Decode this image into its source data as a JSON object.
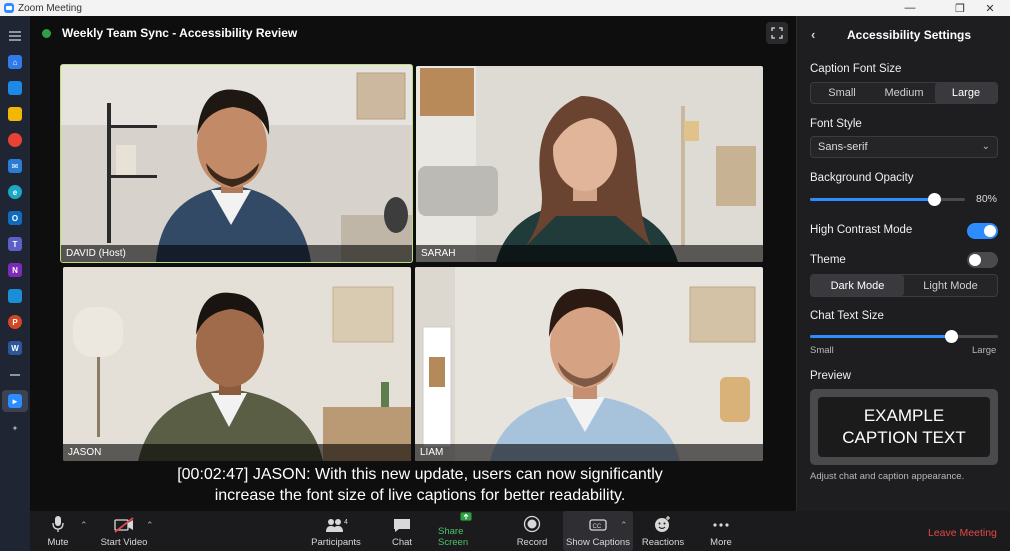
{
  "window": {
    "title": "Zoom Meeting"
  },
  "meeting": {
    "title": "Weekly Team Sync - Accessibility Review"
  },
  "participants": [
    {
      "name": "DAVID (Host)",
      "active_speaker": true
    },
    {
      "name": "SARAH",
      "active_speaker": false
    },
    {
      "name": "JASON",
      "active_speaker": false
    },
    {
      "name": "LIAM",
      "active_speaker": false
    }
  ],
  "caption": {
    "line1": "[00:02:47]  JASON: With this new update, users can now significantly",
    "line2": "increase the font size of live captions for better readability."
  },
  "panel": {
    "title": "Accessibility Settings",
    "caption_font_size": {
      "label": "Caption Font Size",
      "options": [
        "Small",
        "Medium",
        "Large"
      ],
      "selected": "Large"
    },
    "font_style": {
      "label": "Font Style",
      "value": "Sans-serif"
    },
    "background_opacity": {
      "label": "Background Opacity",
      "value": 0.8,
      "display": "80%"
    },
    "high_contrast": {
      "label": "High Contrast Mode",
      "on": true
    },
    "theme": {
      "label": "Theme",
      "on": false,
      "options": [
        "Dark Mode",
        "Light Mode"
      ],
      "selected": "Dark Mode"
    },
    "chat_text_size": {
      "label": "Chat Text Size",
      "value": 0.75,
      "min_label": "Small",
      "max_label": "Large"
    },
    "preview": {
      "label": "Preview",
      "line1": "EXAMPLE",
      "line2": "CAPTION TEXT"
    },
    "footer": "Adjust chat and caption appearance."
  },
  "toolbar": {
    "mute": "Mute",
    "start_video": "Start Video",
    "participants": "Participants",
    "participants_count": "4",
    "chat": "Chat",
    "share_screen": "Share Screen",
    "record": "Record",
    "show_captions": "Show Captions",
    "reactions": "Reactions",
    "more": "More",
    "leave": "Leave Meeting"
  },
  "colors": {
    "accent": "#2d8cff",
    "share_green": "#2ea043",
    "leave_red": "#e04848",
    "active_border": "#b7e07a"
  }
}
